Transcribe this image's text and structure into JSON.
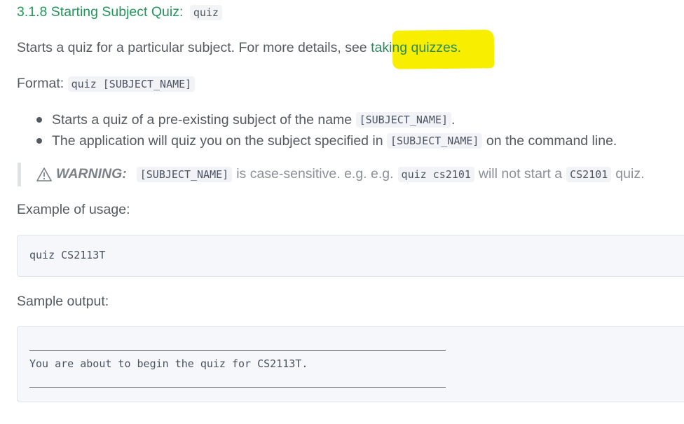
{
  "heading": {
    "text": "3.1.8 Starting Subject Quiz:",
    "code": "quiz"
  },
  "intro": {
    "text": "Starts a quiz for a particular subject. For more details, see",
    "link": "taking quizzes."
  },
  "format": {
    "label": "Format:",
    "code": "quiz [SUBJECT_NAME]"
  },
  "bullets": [
    {
      "before": "Starts a quiz of a pre-existing subject of the name",
      "code": "[SUBJECT_NAME]",
      "after": "."
    },
    {
      "before": "The application will quiz you on the subject specified in",
      "code": "[SUBJECT_NAME]",
      "after": "on the command line."
    }
  ],
  "warning": {
    "icon": "warning-triangle-icon",
    "label": "WARNING:",
    "code1": "[SUBJECT_NAME]",
    "text1": "is case-sensitive. e.g. e.g.",
    "code2": "quiz cs2101",
    "text2": "will not start a",
    "code3": "CS2101",
    "text3": "quiz."
  },
  "example": {
    "label": "Example of usage:",
    "code": "quiz CS2113T"
  },
  "sample": {
    "label": "Sample output:",
    "output": "You are about to begin the quiz for CS2113T."
  },
  "colors": {
    "heading": "#23975b",
    "highlight": "#f7ee00",
    "text": "#555a60"
  }
}
